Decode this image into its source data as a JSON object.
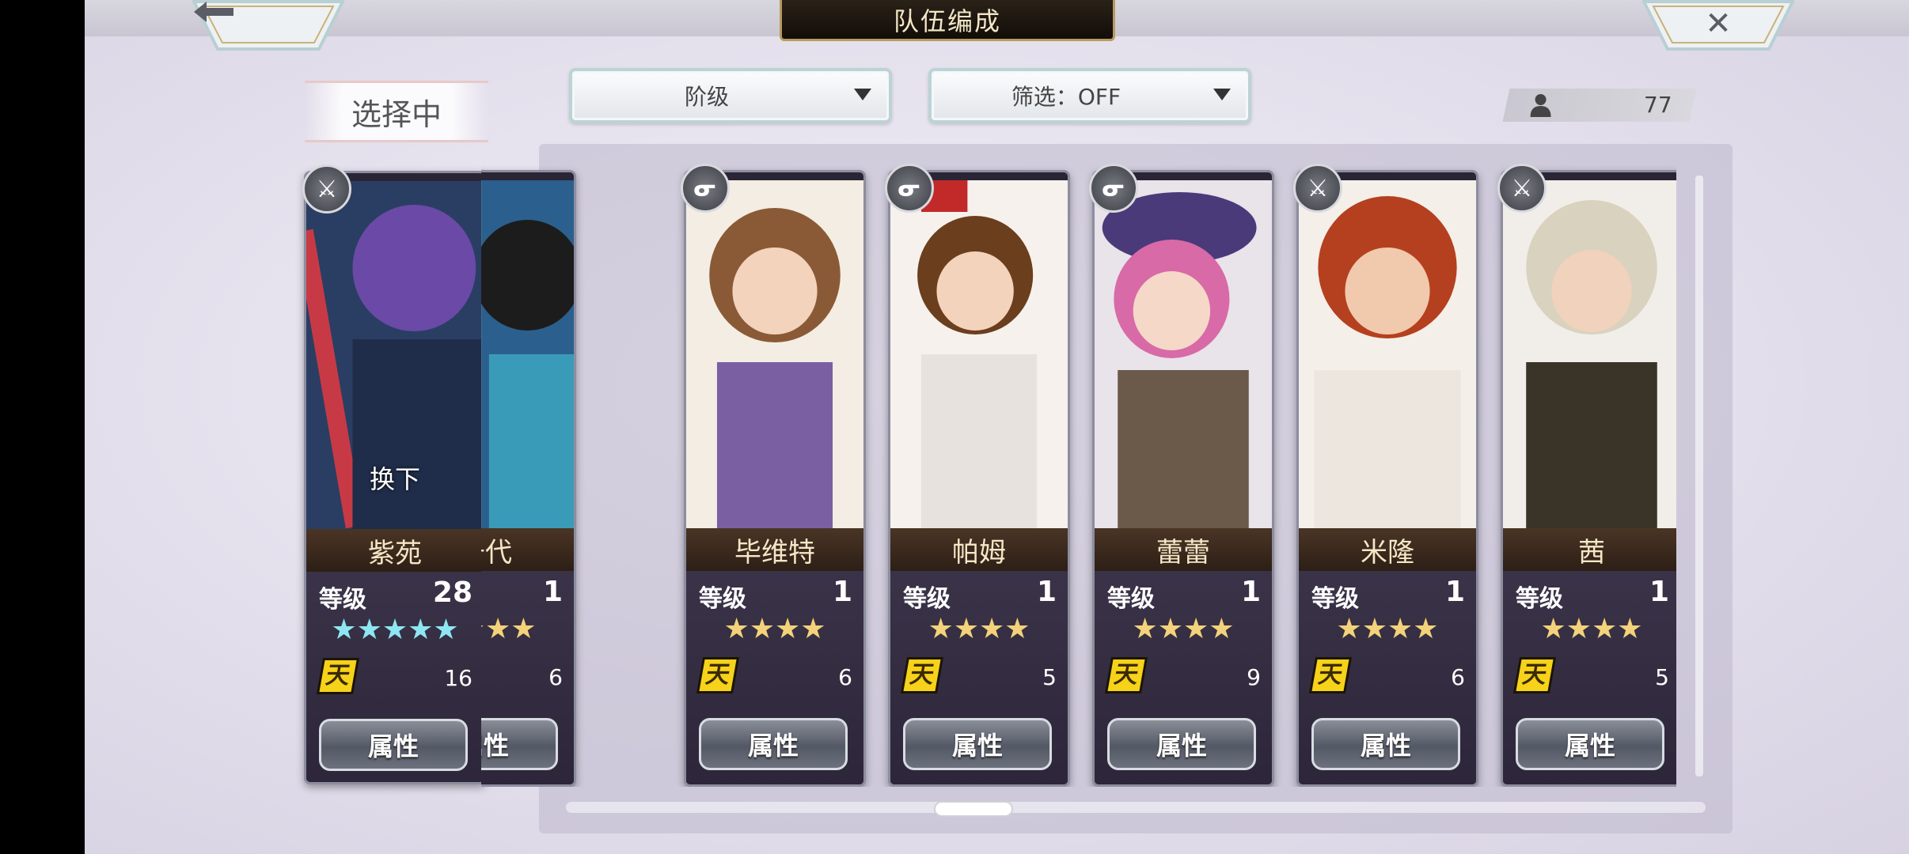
{
  "header": {
    "title": "队伍编成",
    "back_icon": "left-arrow-icon",
    "close_icon": "close-x-icon"
  },
  "selecting": {
    "label": "选择中"
  },
  "filters": {
    "rank_label": "阶级",
    "filter_label": "筛选：OFF"
  },
  "roster": {
    "count": "77",
    "icon": "user-icon"
  },
  "selected_card": {
    "name": "紫苑",
    "level_label": "等级",
    "level": "28",
    "stars": "★★★★★",
    "star_color": "#8ee6f2",
    "tian_label": "天",
    "tian_count": "16",
    "attr_label": "属性",
    "swap_label": "换下",
    "weapon": "sword-icon"
  },
  "cards": [
    {
      "name": "千代",
      "level_label": "等级",
      "level": "1",
      "stars": "★★★★",
      "tian_label": "天",
      "tian_count": "6",
      "attr_label": "属性",
      "weapon": "staff-icon"
    },
    {
      "name": "毕维特",
      "level_label": "等级",
      "level": "1",
      "stars": "★★★★",
      "tian_label": "天",
      "tian_count": "6",
      "attr_label": "属性",
      "weapon": "staff-icon"
    },
    {
      "name": "帕姆",
      "level_label": "等级",
      "level": "1",
      "stars": "★★★★",
      "tian_label": "天",
      "tian_count": "5",
      "attr_label": "属性",
      "weapon": "staff-icon"
    },
    {
      "name": "蕾蕾",
      "level_label": "等级",
      "level": "1",
      "stars": "★★★★",
      "tian_label": "天",
      "tian_count": "9",
      "attr_label": "属性",
      "weapon": "staff-icon"
    },
    {
      "name": "米隆",
      "level_label": "等级",
      "level": "1",
      "stars": "★★★★",
      "tian_label": "天",
      "tian_count": "6",
      "attr_label": "属性",
      "weapon": "sword-icon"
    },
    {
      "name": "茜",
      "level_label": "等级",
      "level": "1",
      "stars": "★★★★",
      "tian_label": "天",
      "tian_count": "5",
      "attr_label": "属性",
      "weapon": "sword-icon"
    }
  ],
  "colors": {
    "accent_gold": "#b79a5e",
    "star_gold": "#f3d27a",
    "tian_yellow": "#f6d21a"
  }
}
